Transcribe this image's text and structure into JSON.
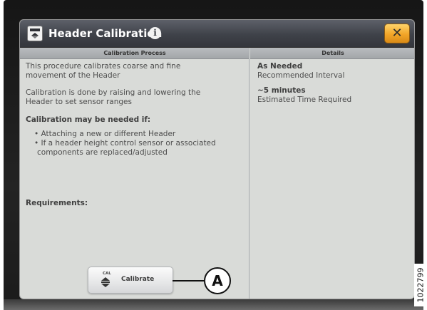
{
  "dialog": {
    "title": "Header Calibration",
    "info_glyph": "i",
    "close_glyph": "✕",
    "icon": "header-icon"
  },
  "left_column": {
    "header": "Calibration Process",
    "para1_line1": "This procedure calibrates coarse and fine",
    "para1_line2": "movement of the Header",
    "para2_line1": "Calibration is done by raising and lowering the",
    "para2_line2": "Header to set sensor ranges",
    "needed_heading": "Calibration may be needed if:",
    "bullet1": "• Attaching a new or different Header",
    "bullet2_line1": "• If a header height control sensor or associated",
    "bullet2_line2": "components are replaced/adjusted",
    "requirements_heading": "Requirements:"
  },
  "right_column": {
    "header": "Details",
    "interval_value": "As Needed",
    "interval_label": "Recommended Interval",
    "time_value": "~5 minutes",
    "time_label": "Estimated Time Required"
  },
  "calibrate_button": {
    "small_label": "CAL",
    "label": "Calibrate",
    "icon": "calibrate-arrows-icon"
  },
  "callout": {
    "letter": "A"
  },
  "figure_id": "1022799",
  "colors": {
    "close_button": "#f2a528",
    "title_bar": "#3f4249",
    "dialog_bg": "#d9dbd8"
  }
}
